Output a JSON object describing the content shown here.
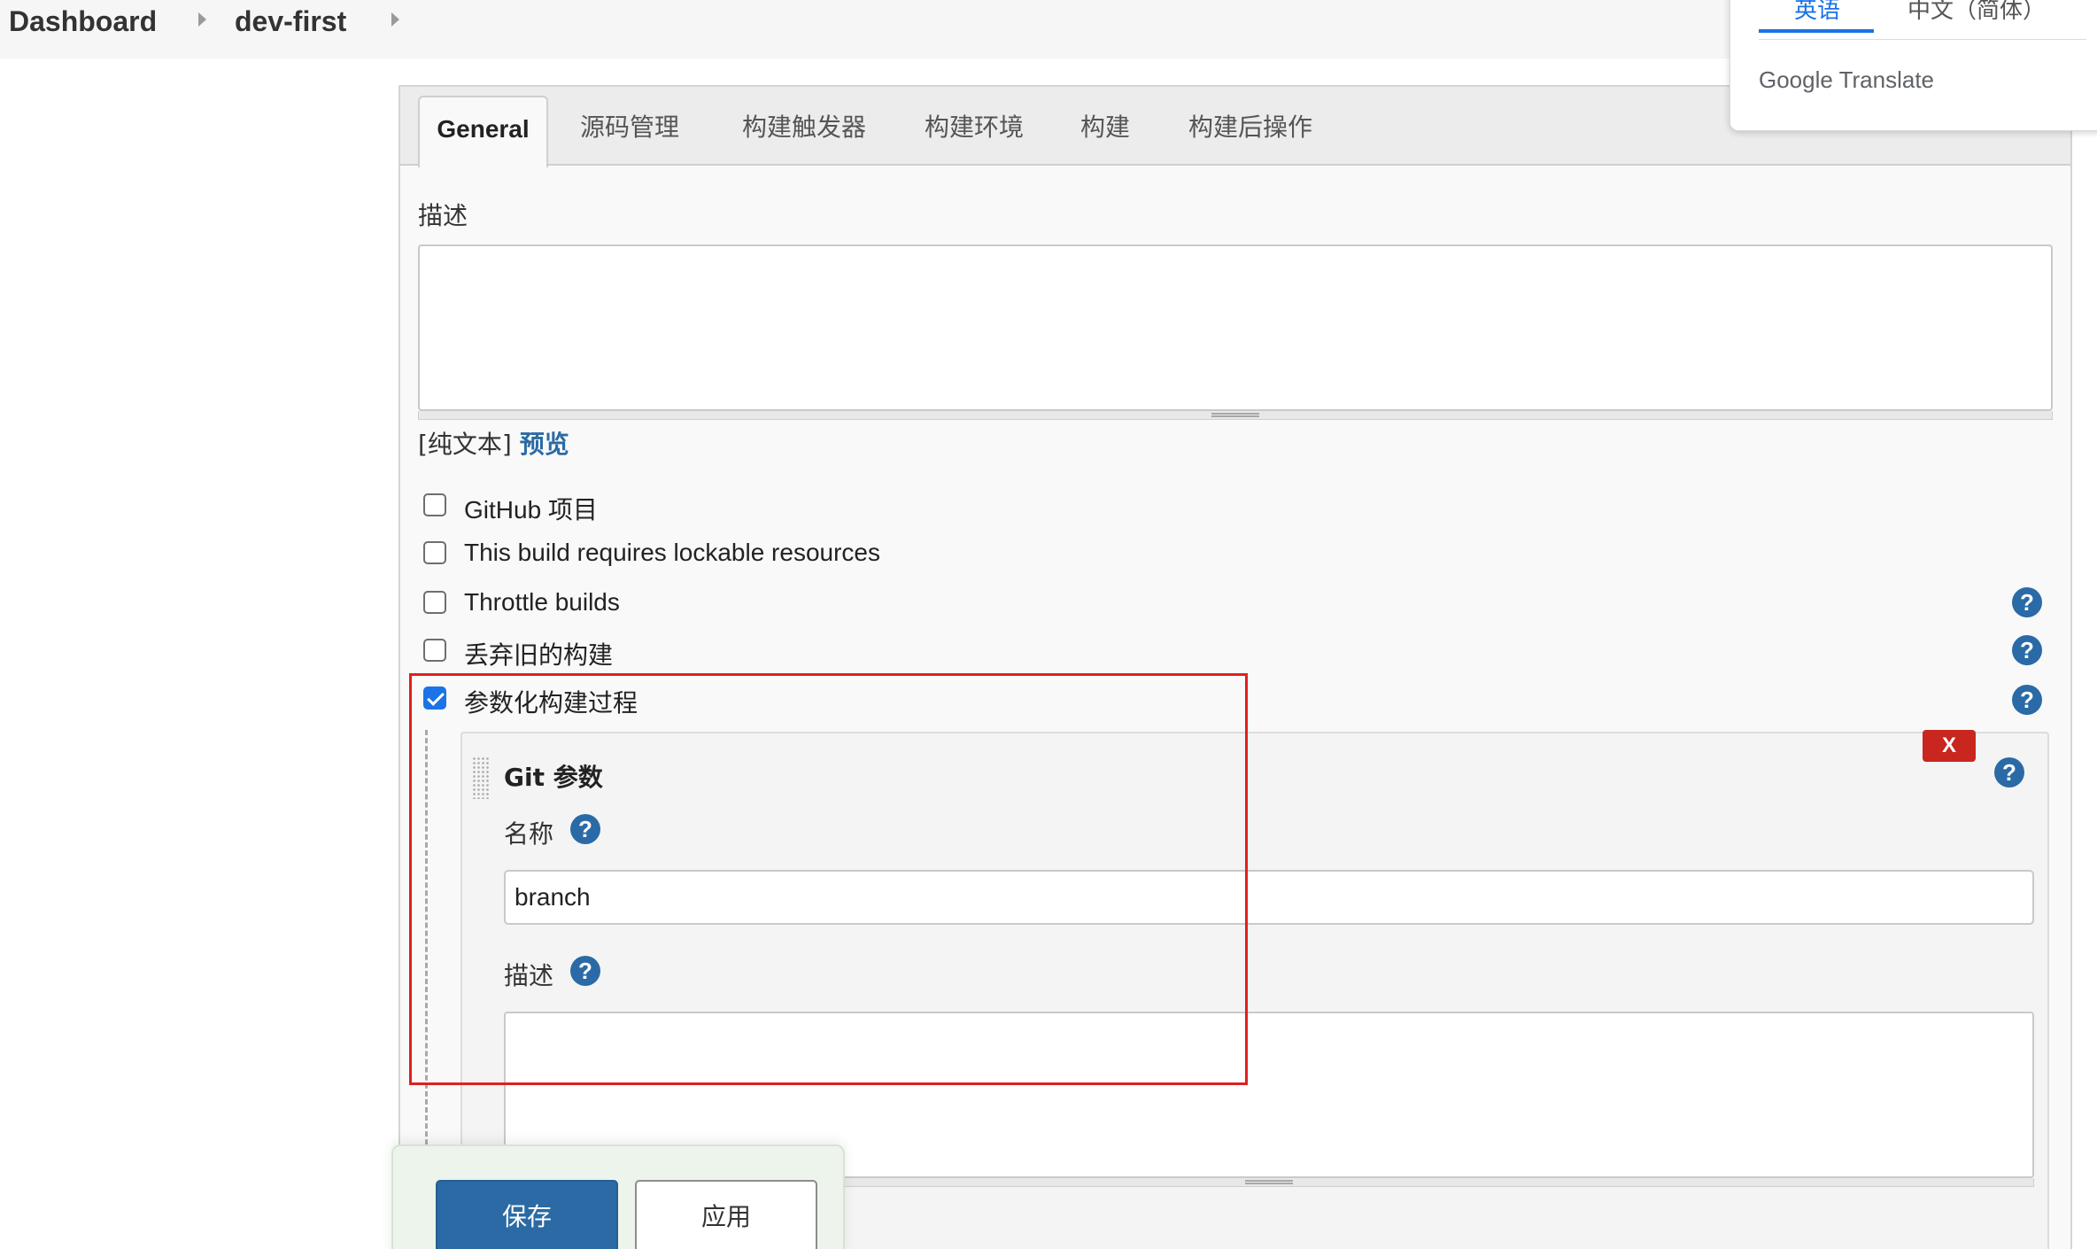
{
  "breadcrumb": {
    "items": [
      "Dashboard",
      "dev-first"
    ]
  },
  "tabs": [
    "General",
    "源码管理",
    "构建触发器",
    "构建环境",
    "构建",
    "构建后操作"
  ],
  "general": {
    "description_label": "描述",
    "description_value": "",
    "format_prefix": "[纯文本]",
    "preview_link": "预览",
    "options": [
      {
        "label": "GitHub 项目",
        "checked": false
      },
      {
        "label": "This build requires lockable resources",
        "checked": false
      },
      {
        "label": "Throttle builds",
        "checked": false
      },
      {
        "label": "丢弃旧的构建",
        "checked": false
      },
      {
        "label": "参数化构建过程",
        "checked": true
      }
    ]
  },
  "git_parameter": {
    "title": "Git 参数",
    "delete_label": "X",
    "name_label": "名称",
    "name_value": "branch",
    "desc_label": "描述",
    "desc_value": ""
  },
  "help_icon_glyph": "?",
  "actions": {
    "save": "保存",
    "apply": "应用"
  },
  "translate": {
    "lang_source": "英语",
    "lang_target": "中文（简体）",
    "brand": "Google Translate"
  },
  "colors": {
    "link": "#2b6aa4",
    "primary_button": "#2b6aa4",
    "delete_button": "#c8261f",
    "annotation_red": "#e0201f",
    "translate_active": "#1a73e8"
  },
  "icons": [
    "help-icon",
    "checkbox-checked-icon",
    "drag-handle-icon",
    "resize-grip-icon",
    "breadcrumb-chevron-icon"
  ]
}
